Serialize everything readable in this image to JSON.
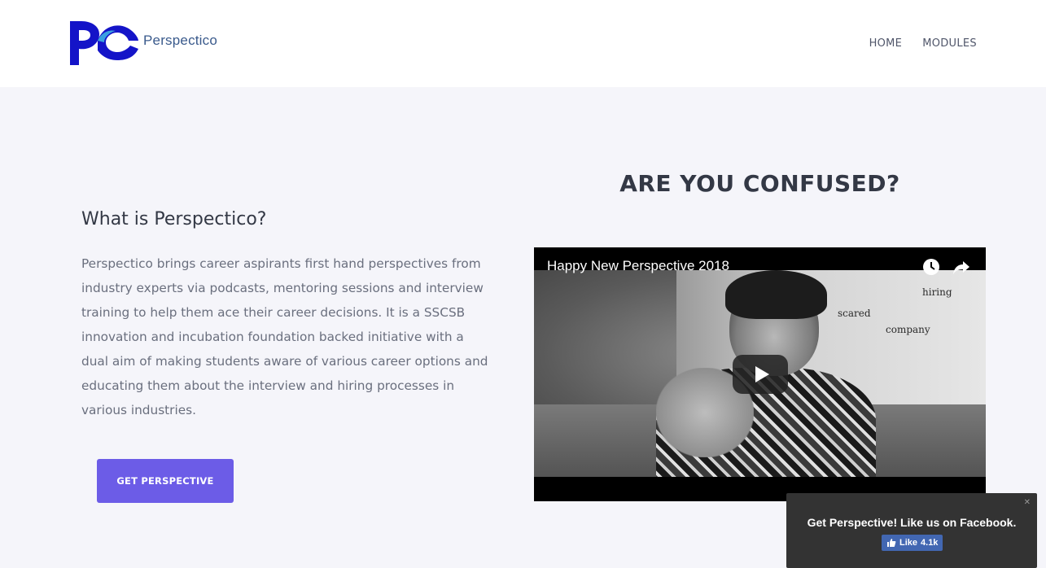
{
  "header": {
    "logo_text": "Perspectico",
    "nav": [
      {
        "label": "HOME"
      },
      {
        "label": "MODULES"
      }
    ]
  },
  "about": {
    "title": "What is Perspectico?",
    "body": "Perspectico brings career aspirants first hand perspectives from industry experts via podcasts, mentoring sessions and interview training to help them ace their career decisions. It is a SSCSB innovation and incubation foundation backed initiative with a dual aim of making students aware of various career options and educating them about the interview and hiring processes in various industries.",
    "cta_label": "GET PERSPECTIVE"
  },
  "video_section": {
    "heading": "ARE YOU CONFUSED?",
    "video_title": "Happy New Perspective 2018",
    "words": [
      "hiring",
      "scared",
      "company"
    ]
  },
  "facebook_popup": {
    "text": "Get Perspective! Like us on Facebook.",
    "like_label": "Like",
    "like_count": "4.1k"
  },
  "colors": {
    "accent": "#6c5ce7",
    "logo_blue": "#1a1ad4",
    "fb_blue": "#4267b2"
  }
}
